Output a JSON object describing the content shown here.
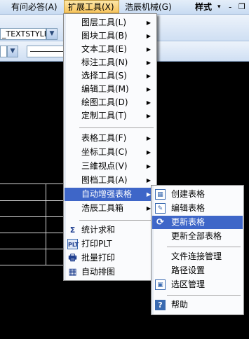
{
  "menubar": {
    "items": [
      {
        "label": "有问必答(A)"
      },
      {
        "label": "扩展工具(X)"
      },
      {
        "label": "浩辰机械(G)"
      }
    ],
    "style_label": "样式",
    "minimize": "-",
    "restore": "❐"
  },
  "toolbar": {
    "textstyle_value": "_TEXTSTYLE"
  },
  "menus": {
    "extend_tools": {
      "items": [
        {
          "label": "图层工具(L)",
          "submenu": true
        },
        {
          "label": "图块工具(B)",
          "submenu": true
        },
        {
          "label": "文本工具(E)",
          "submenu": true
        },
        {
          "label": "标注工具(N)",
          "submenu": true
        },
        {
          "label": "选择工具(S)",
          "submenu": true
        },
        {
          "label": "编辑工具(M)",
          "submenu": true
        },
        {
          "label": "绘图工具(D)",
          "submenu": true
        },
        {
          "label": "定制工具(T)",
          "submenu": true
        },
        {
          "label": "表格工具(F)",
          "submenu": true
        },
        {
          "label": "坐标工具(C)",
          "submenu": true
        },
        {
          "label": "三維视点(V)",
          "submenu": true
        },
        {
          "label": "图档工具(A)",
          "submenu": true
        },
        {
          "label": "自动增强表格",
          "submenu": true,
          "highlighted": true
        },
        {
          "label": "浩辰工具箱",
          "submenu": true
        },
        {
          "label": "统计求和",
          "icon": "sigma-icon"
        },
        {
          "label": "打印PLT",
          "icon": "plt-icon"
        },
        {
          "label": "批量打印",
          "icon": "batch-print-icon"
        },
        {
          "label": "自动排图",
          "icon": "auto-layout-icon"
        }
      ]
    },
    "auto_table": {
      "items": [
        {
          "label": "创建表格",
          "icon": "create-table-icon"
        },
        {
          "label": "编辑表格",
          "icon": "edit-table-icon"
        },
        {
          "label": "更新表格",
          "icon": "update-table-icon",
          "highlighted": true
        },
        {
          "label": "更新全部表格"
        },
        {
          "label": "文件连接管理"
        },
        {
          "label": "路径设置"
        },
        {
          "label": "选区管理",
          "icon": "selection-manage-icon"
        },
        {
          "label": "帮助",
          "icon": "help-icon"
        }
      ]
    }
  },
  "colors": {
    "highlight": "#3e66c8",
    "canvas": "#000000",
    "menu_bg": "#fafbfd"
  }
}
